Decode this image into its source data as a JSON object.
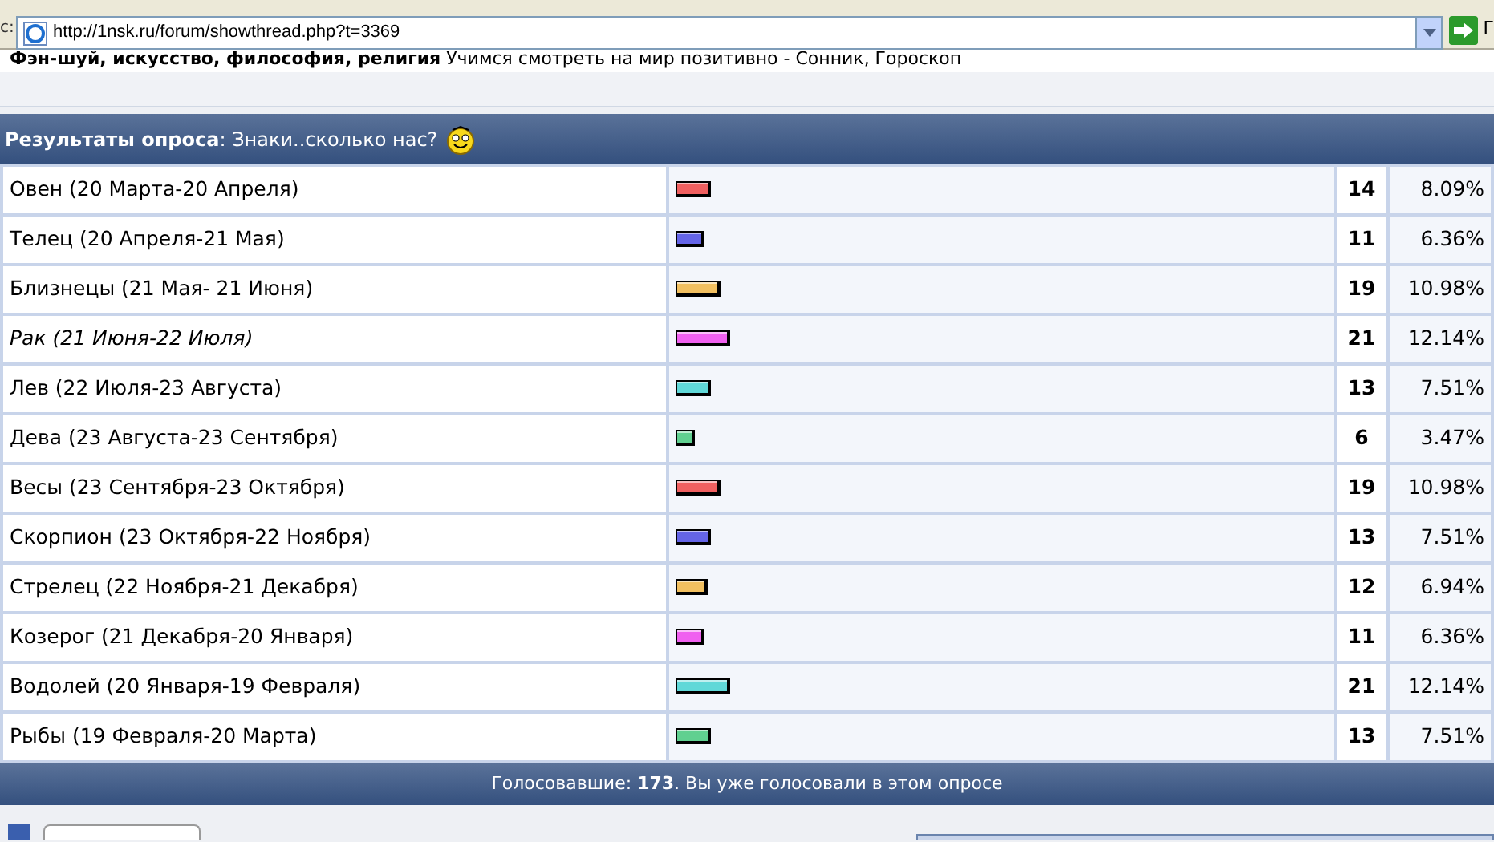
{
  "browser": {
    "address_label": "c:",
    "address": "http://1nsk.ru/forum/showthread.php?t=3369",
    "go_label": "Г"
  },
  "forum_line": {
    "title": "Фэн-шуй, искусство, философия, религия",
    "description": "Учимся смотреть на мир позитивно - Сонник, Гороскоп"
  },
  "poll": {
    "heading": "**Результаты опроса**: Знаки..сколько нас?",
    "options": [
      {
        "label": "Овен (20 Марта-20 Апреля)",
        "italic": false,
        "color": "#f06060",
        "level": 0.054,
        "votes": "14",
        "percent": "8.09%"
      },
      {
        "label": "Телец (20 Апреля-21 Мая)",
        "italic": false,
        "color": "#6464e6",
        "level": 0.044,
        "votes": "11",
        "percent": "6.36%"
      },
      {
        "label": "Близнецы (21 Мая- 21 Июня)",
        "italic": false,
        "color": "#f2c060",
        "level": 0.068,
        "votes": "19",
        "percent": "10.98%"
      },
      {
        "label": "Рак (21 Июня-22 Июля)",
        "italic": true,
        "color": "#f060f0",
        "level": 0.083,
        "votes": "21",
        "percent": "12.14%"
      },
      {
        "label": "Лев (22 Июля-23 Августа)",
        "italic": false,
        "color": "#60d8d8",
        "level": 0.054,
        "votes": "13",
        "percent": "7.51%"
      },
      {
        "label": "Дева (23 Августа-23 Сентября)",
        "italic": false,
        "color": "#60d090",
        "level": 0.029,
        "votes": "6",
        "percent": "3.47%"
      },
      {
        "label": "Весы (23 Сентября-23 Октября)",
        "italic": false,
        "color": "#f06060",
        "level": 0.068,
        "votes": "19",
        "percent": "10.98%"
      },
      {
        "label": "Скорпион (23 Октября-22 Ноября)",
        "italic": false,
        "color": "#6464e6",
        "level": 0.054,
        "votes": "13",
        "percent": "7.51%"
      },
      {
        "label": "Стрелец (22 Ноября-21 Декабря)",
        "italic": false,
        "color": "#f2c060",
        "level": 0.049,
        "votes": "12",
        "percent": "6.94%"
      },
      {
        "label": "Козерог (21 Декабря-20 Января)",
        "italic": false,
        "color": "#f060f0",
        "level": 0.044,
        "votes": "11",
        "percent": "6.36%"
      },
      {
        "label": "Водолей (20 Января-19 Февраля)",
        "italic": false,
        "color": "#60d8d8",
        "level": 0.083,
        "votes": "21",
        "percent": "12.14%"
      },
      {
        "label": "Рыбы (19 Февраля-20 Марта)",
        "italic": false,
        "color": "#60d090",
        "level": 0.054,
        "votes": "13",
        "percent": "7.51%"
      }
    ],
    "footer": "Голосовавшие: **173**. Вы уже голосовали в этом опросе"
  }
}
